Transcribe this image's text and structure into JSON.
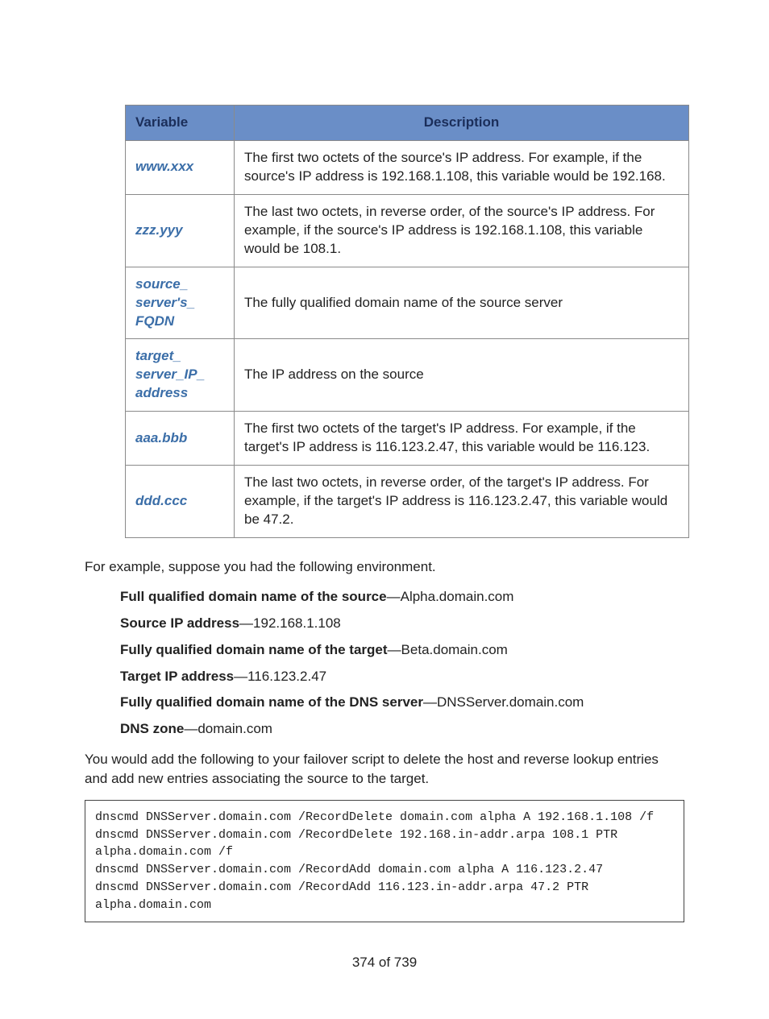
{
  "table": {
    "headers": {
      "variable": "Variable",
      "description": "Description"
    },
    "rows": [
      {
        "var": "www.xxx",
        "desc": "The first two octets of the source's IP address. For example, if the source's IP address is 192.168.1.108, this variable would be 192.168."
      },
      {
        "var": "zzz.yyy",
        "desc": "The last two octets, in reverse order, of the source's IP address. For example, if the source's IP address is 192.168.1.108, this variable would be 108.1."
      },
      {
        "var": "source_\nserver's_\nFQDN",
        "desc": "The fully qualified domain name of the source server"
      },
      {
        "var": "target_\nserver_IP_\naddress",
        "desc": "The IP address on the source"
      },
      {
        "var": "aaa.bbb",
        "desc": "The first two octets of the target's IP address. For example, if the target's IP address is 116.123.2.47, this variable would be 116.123."
      },
      {
        "var": "ddd.ccc",
        "desc": "The last two octets, in reverse order, of the target's IP address. For example, if the target's IP address is 116.123.2.47, this variable would be 47.2."
      }
    ]
  },
  "intro_text": "For example, suppose you had the following environment.",
  "env": [
    {
      "label": "Full qualified domain name of the source",
      "value": "—Alpha.domain.com"
    },
    {
      "label": "Source IP address",
      "value": "—192.168.1.108"
    },
    {
      "label": "Fully qualified domain name of the target",
      "value": "—Beta.domain.com"
    },
    {
      "label": "Target IP address",
      "value": "—116.123.2.47"
    },
    {
      "label": "Fully qualified domain name of the DNS server",
      "value": "—DNSServer.domain.com"
    },
    {
      "label": "DNS zone",
      "value": "—domain.com"
    }
  ],
  "after_text": "You would add the following to your failover script to delete the host and reverse lookup entries and add new entries associating the source to the target.",
  "code": "dnscmd DNSServer.domain.com /RecordDelete domain.com alpha A 192.168.1.108 /f\ndnscmd DNSServer.domain.com /RecordDelete 192.168.in-addr.arpa 108.1 PTR alpha.domain.com /f\ndnscmd DNSServer.domain.com /RecordAdd domain.com alpha A 116.123.2.47\ndnscmd DNSServer.domain.com /RecordAdd 116.123.in-addr.arpa 47.2 PTR alpha.domain.com",
  "footer": "374 of 739"
}
